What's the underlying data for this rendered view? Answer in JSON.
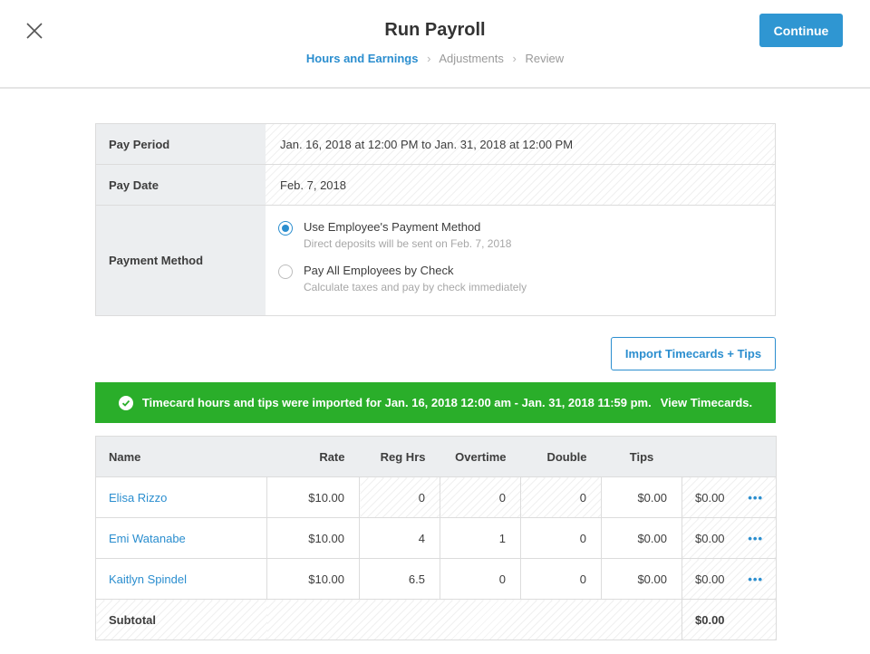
{
  "header": {
    "title": "Run Payroll",
    "steps": [
      "Hours and Earnings",
      "Adjustments",
      "Review"
    ],
    "step_sep": "›",
    "continue_label": "Continue"
  },
  "info": {
    "pay_period_label": "Pay Period",
    "pay_period_value": "Jan. 16, 2018 at 12:00 PM to Jan. 31, 2018 at 12:00 PM",
    "pay_date_label": "Pay Date",
    "pay_date_value": "Feb. 7, 2018",
    "payment_method_label": "Payment Method",
    "options": [
      {
        "title": "Use Employee's Payment Method",
        "subtitle": "Direct deposits will be sent on Feb. 7, 2018",
        "selected": true
      },
      {
        "title": "Pay All Employees by Check",
        "subtitle": "Calculate taxes and pay by check immediately",
        "selected": false
      }
    ]
  },
  "import_label": "Import Timecards + Tips",
  "banner": {
    "text": "Timecard hours and tips were imported for Jan. 16, 2018 12:00 am - Jan. 31, 2018 11:59 pm.",
    "link": "View Timecards."
  },
  "table": {
    "headers": {
      "name": "Name",
      "rate": "Rate",
      "reg": "Reg Hrs",
      "ot": "Overtime",
      "dbl": "Double",
      "tips": "Tips",
      "total": ""
    },
    "rows": [
      {
        "name": "Elisa Rizzo",
        "rate": "$10.00",
        "reg": "0",
        "ot": "0",
        "dbl": "0",
        "tips": "$0.00",
        "total": "$0.00"
      },
      {
        "name": "Emi Watanabe",
        "rate": "$10.00",
        "reg": "4",
        "ot": "1",
        "dbl": "0",
        "tips": "$0.00",
        "total": "$0.00"
      },
      {
        "name": "Kaitlyn Spindel",
        "rate": "$10.00",
        "reg": "6.5",
        "ot": "0",
        "dbl": "0",
        "tips": "$0.00",
        "total": "$0.00"
      }
    ],
    "more_glyph": "•••",
    "subtotal_label": "Subtotal",
    "subtotal_value": "$0.00"
  },
  "colors": {
    "accent": "#2b8ecf",
    "success": "#2aae2a"
  }
}
